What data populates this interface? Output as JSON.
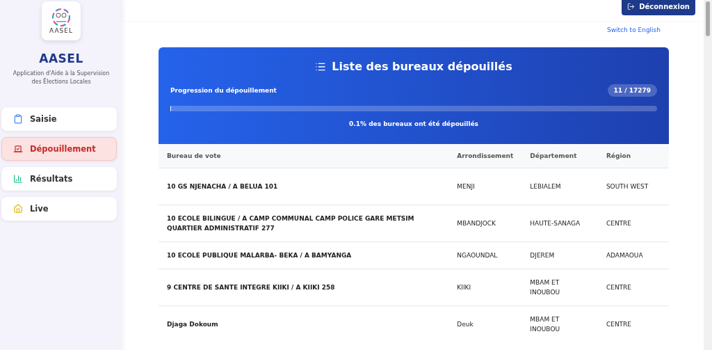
{
  "sidebar": {
    "logo_text": "AASEL",
    "app_name": "AASEL",
    "subtitle": "Application d'Aide à la Supervision des Élections Locales",
    "items": [
      {
        "label": "Saisie",
        "selected": false
      },
      {
        "label": "Dépouillement",
        "selected": true
      },
      {
        "label": "Résultats",
        "selected": false
      },
      {
        "label": "Live",
        "selected": false
      }
    ]
  },
  "header": {
    "logout": "Déconnexion",
    "language_link": "Switch to English"
  },
  "card": {
    "title": "Liste des bureaux dépouillés",
    "progress_label": "Progression du dépouillement",
    "count": "11 / 17279",
    "level": 0.001,
    "caption": "0.1% des bureaux ont été dépouillés"
  },
  "table": {
    "columns": [
      "Bureau de vote",
      "Arrondissement",
      "Département",
      "Région"
    ],
    "rows": [
      [
        "10 GS NJENACHA / A BELUA 101",
        "MENJI",
        "LEBIALEM",
        "SOUTH WEST"
      ],
      [
        "10 ECOLE BILINGUE / A CAMP COMMUNAL CAMP POLICE GARE METSIM QUARTIER ADMINISTRATIF 277",
        "MBANDJOCK",
        "HAUTE-SANAGA",
        "CENTRE"
      ],
      [
        "10 ECOLE PUBLIQUE MALARBA- BEKA / A BAMYANGA",
        "NGAOUNDAL",
        "DJEREM",
        "ADAMAOUA"
      ],
      [
        "9 CENTRE DE SANTE INTEGRE KIIKI / A KIIKI 258",
        "KIIKI",
        "MBAM ET INOUBOU",
        "CENTRE"
      ],
      [
        "Djaga Dokoum",
        "Deuk",
        "MBAM ET INOUBOU",
        "CENTRE"
      ]
    ]
  }
}
